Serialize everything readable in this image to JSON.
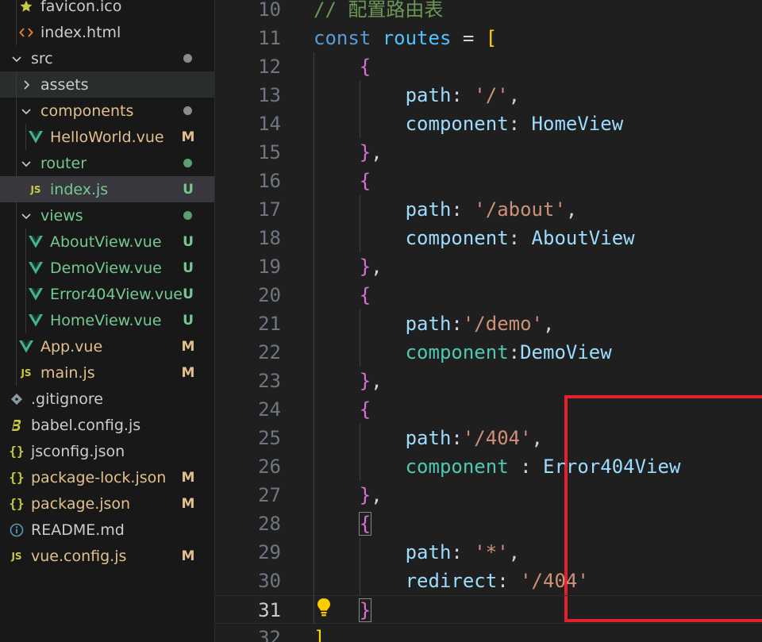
{
  "explorer": {
    "items": [
      {
        "label": "favicon.ico",
        "icon": "star-icon",
        "indent": 1,
        "kind": "file",
        "icon_color": "#cbcb41",
        "label_color": "#cccccc",
        "badge": "",
        "dot": ""
      },
      {
        "label": "index.html",
        "icon": "html-code-icon",
        "indent": 1,
        "kind": "file",
        "icon_color": "#e37933",
        "label_color": "#cccccc",
        "badge": "",
        "dot": ""
      },
      {
        "label": "src",
        "icon": "chevron-down-icon",
        "indent": 0,
        "kind": "folder",
        "icon_color": "#cccccc",
        "label_color": "#cccccc",
        "badge": "",
        "dot": "#8b8b8b"
      },
      {
        "label": "assets",
        "icon": "chevron-right-icon",
        "indent": 1,
        "kind": "folder",
        "icon_color": "#cccccc",
        "label_color": "#cccccc",
        "badge": "",
        "dot": "",
        "state": "hover"
      },
      {
        "label": "components",
        "icon": "chevron-down-icon",
        "indent": 1,
        "kind": "folder",
        "icon_color": "#cccccc",
        "label_color": "#e2c08d",
        "badge": "",
        "dot": "#8b8b8b"
      },
      {
        "label": "HelloWorld.vue",
        "icon": "vue-icon",
        "indent": 2,
        "kind": "file",
        "icon_color": "#41b883",
        "label_color": "#e2c08d",
        "badge": "M",
        "badge_color": "#e2c08d",
        "dot": ""
      },
      {
        "label": "router",
        "icon": "chevron-down-icon",
        "indent": 1,
        "kind": "folder",
        "icon_color": "#cccccc",
        "label_color": "#73c991",
        "badge": "",
        "dot": "#5a9f6e"
      },
      {
        "label": "index.js",
        "icon": "js-icon",
        "indent": 2,
        "kind": "file",
        "icon_color": "#cbcb41",
        "label_color": "#73c991",
        "badge": "U",
        "badge_color": "#73c991",
        "dot": "",
        "state": "selected"
      },
      {
        "label": "views",
        "icon": "chevron-down-icon",
        "indent": 1,
        "kind": "folder",
        "icon_color": "#cccccc",
        "label_color": "#73c991",
        "badge": "",
        "dot": "#5a9f6e"
      },
      {
        "label": "AboutView.vue",
        "icon": "vue-icon",
        "indent": 2,
        "kind": "file",
        "icon_color": "#41b883",
        "label_color": "#73c991",
        "badge": "U",
        "badge_color": "#73c991",
        "dot": ""
      },
      {
        "label": "DemoView.vue",
        "icon": "vue-icon",
        "indent": 2,
        "kind": "file",
        "icon_color": "#41b883",
        "label_color": "#73c991",
        "badge": "U",
        "badge_color": "#73c991",
        "dot": ""
      },
      {
        "label": "Error404View.vue",
        "icon": "vue-icon",
        "indent": 2,
        "kind": "file",
        "icon_color": "#41b883",
        "label_color": "#73c991",
        "badge": "U",
        "badge_color": "#73c991",
        "dot": ""
      },
      {
        "label": "HomeView.vue",
        "icon": "vue-icon",
        "indent": 2,
        "kind": "file",
        "icon_color": "#41b883",
        "label_color": "#73c991",
        "badge": "U",
        "badge_color": "#73c991",
        "dot": ""
      },
      {
        "label": "App.vue",
        "icon": "vue-icon",
        "indent": 1,
        "kind": "file",
        "icon_color": "#41b883",
        "label_color": "#e2c08d",
        "badge": "M",
        "badge_color": "#e2c08d",
        "dot": ""
      },
      {
        "label": "main.js",
        "icon": "js-icon",
        "indent": 1,
        "kind": "file",
        "icon_color": "#cbcb41",
        "label_color": "#e2c08d",
        "badge": "M",
        "badge_color": "#e2c08d",
        "dot": ""
      },
      {
        "label": ".gitignore",
        "icon": "git-icon",
        "indent": 0,
        "kind": "file",
        "icon_color": "#41535b",
        "label_color": "#cccccc",
        "badge": "",
        "dot": ""
      },
      {
        "label": "babel.config.js",
        "icon": "babel-icon",
        "indent": 0,
        "kind": "file",
        "icon_color": "#cbcb41",
        "label_color": "#cccccc",
        "badge": "",
        "dot": ""
      },
      {
        "label": "jsconfig.json",
        "icon": "json-braces-icon",
        "indent": 0,
        "kind": "file",
        "icon_color": "#cbcb41",
        "label_color": "#cccccc",
        "badge": "",
        "dot": ""
      },
      {
        "label": "package-lock.json",
        "icon": "json-braces-icon",
        "indent": 0,
        "kind": "file",
        "icon_color": "#cbcb41",
        "label_color": "#e2c08d",
        "badge": "M",
        "badge_color": "#e2c08d",
        "dot": ""
      },
      {
        "label": "package.json",
        "icon": "json-braces-icon",
        "indent": 0,
        "kind": "file",
        "icon_color": "#cbcb41",
        "label_color": "#e2c08d",
        "badge": "M",
        "badge_color": "#e2c08d",
        "dot": ""
      },
      {
        "label": "README.md",
        "icon": "info-icon",
        "indent": 0,
        "kind": "file",
        "icon_color": "#519aba",
        "label_color": "#cccccc",
        "badge": "",
        "dot": ""
      },
      {
        "label": "vue.config.js",
        "icon": "js-icon",
        "indent": 0,
        "kind": "file",
        "icon_color": "#cbcb41",
        "label_color": "#e2c08d",
        "badge": "M",
        "badge_color": "#e2c08d",
        "dot": ""
      }
    ]
  },
  "editor": {
    "current_line": 31,
    "colors": {
      "comment": "#6a9955",
      "keyword": "#569cd6",
      "variable": "#4fc1ff",
      "property": "#9cdcfe",
      "string": "#ce9178",
      "class": "#4ec9b0",
      "punct": "#d4d4d4",
      "bracket1": "#ffd700",
      "bracket2": "#da70d6"
    },
    "lines": [
      {
        "num": "10",
        "tokens": [
          {
            "t": "// 配置路由表",
            "c": "comment"
          }
        ]
      },
      {
        "num": "11",
        "tokens": [
          {
            "t": "const",
            "c": "keyword"
          },
          {
            "t": " ",
            "c": "punct"
          },
          {
            "t": "routes",
            "c": "variable"
          },
          {
            "t": " = ",
            "c": "punct"
          },
          {
            "t": "[",
            "c": "bracket1"
          }
        ]
      },
      {
        "num": "12",
        "tokens": [
          {
            "t": "    ",
            "c": "punct"
          },
          {
            "t": "{",
            "c": "bracket2"
          }
        ]
      },
      {
        "num": "13",
        "tokens": [
          {
            "t": "        ",
            "c": "punct"
          },
          {
            "t": "path",
            "c": "property"
          },
          {
            "t": ": ",
            "c": "punct"
          },
          {
            "t": "'/'",
            "c": "string"
          },
          {
            "t": ",",
            "c": "punct"
          }
        ]
      },
      {
        "num": "14",
        "tokens": [
          {
            "t": "        ",
            "c": "punct"
          },
          {
            "t": "component",
            "c": "property"
          },
          {
            "t": ": ",
            "c": "punct"
          },
          {
            "t": "HomeView",
            "c": "property"
          }
        ]
      },
      {
        "num": "15",
        "tokens": [
          {
            "t": "    ",
            "c": "punct"
          },
          {
            "t": "}",
            "c": "bracket2"
          },
          {
            "t": ",",
            "c": "punct"
          }
        ]
      },
      {
        "num": "16",
        "tokens": [
          {
            "t": "    ",
            "c": "punct"
          },
          {
            "t": "{",
            "c": "bracket2"
          }
        ]
      },
      {
        "num": "17",
        "tokens": [
          {
            "t": "        ",
            "c": "punct"
          },
          {
            "t": "path",
            "c": "property"
          },
          {
            "t": ": ",
            "c": "punct"
          },
          {
            "t": "'/about'",
            "c": "string"
          },
          {
            "t": ",",
            "c": "punct"
          }
        ]
      },
      {
        "num": "18",
        "tokens": [
          {
            "t": "        ",
            "c": "punct"
          },
          {
            "t": "component",
            "c": "property"
          },
          {
            "t": ": ",
            "c": "punct"
          },
          {
            "t": "AboutView",
            "c": "property"
          }
        ]
      },
      {
        "num": "19",
        "tokens": [
          {
            "t": "    ",
            "c": "punct"
          },
          {
            "t": "}",
            "c": "bracket2"
          },
          {
            "t": ",",
            "c": "punct"
          }
        ]
      },
      {
        "num": "20",
        "tokens": [
          {
            "t": "    ",
            "c": "punct"
          },
          {
            "t": "{",
            "c": "bracket2"
          }
        ]
      },
      {
        "num": "21",
        "tokens": [
          {
            "t": "        ",
            "c": "punct"
          },
          {
            "t": "path",
            "c": "property"
          },
          {
            "t": ":",
            "c": "punct"
          },
          {
            "t": "'/demo'",
            "c": "string"
          },
          {
            "t": ",",
            "c": "punct"
          }
        ]
      },
      {
        "num": "22",
        "tokens": [
          {
            "t": "        ",
            "c": "punct"
          },
          {
            "t": "component",
            "c": "class"
          },
          {
            "t": ":",
            "c": "punct"
          },
          {
            "t": "DemoView",
            "c": "property"
          }
        ]
      },
      {
        "num": "23",
        "tokens": [
          {
            "t": "    ",
            "c": "punct"
          },
          {
            "t": "}",
            "c": "bracket2"
          },
          {
            "t": ",",
            "c": "punct"
          }
        ]
      },
      {
        "num": "24",
        "tokens": [
          {
            "t": "    ",
            "c": "punct"
          },
          {
            "t": "{",
            "c": "bracket2"
          }
        ]
      },
      {
        "num": "25",
        "tokens": [
          {
            "t": "        ",
            "c": "punct"
          },
          {
            "t": "path",
            "c": "property"
          },
          {
            "t": ":",
            "c": "punct"
          },
          {
            "t": "'/404'",
            "c": "string"
          },
          {
            "t": ",",
            "c": "punct"
          }
        ]
      },
      {
        "num": "26",
        "tokens": [
          {
            "t": "        ",
            "c": "punct"
          },
          {
            "t": "component",
            "c": "class"
          },
          {
            "t": " : ",
            "c": "punct"
          },
          {
            "t": "Error404View",
            "c": "property"
          }
        ]
      },
      {
        "num": "27",
        "tokens": [
          {
            "t": "    ",
            "c": "punct"
          },
          {
            "t": "}",
            "c": "bracket2"
          },
          {
            "t": ",",
            "c": "punct"
          }
        ]
      },
      {
        "num": "28",
        "tokens": [
          {
            "t": "    ",
            "c": "punct"
          },
          {
            "t": "{",
            "c": "bracket2",
            "match": true
          }
        ]
      },
      {
        "num": "29",
        "tokens": [
          {
            "t": "        ",
            "c": "punct"
          },
          {
            "t": "path",
            "c": "property"
          },
          {
            "t": ": ",
            "c": "punct"
          },
          {
            "t": "'*'",
            "c": "string"
          },
          {
            "t": ",",
            "c": "punct"
          }
        ]
      },
      {
        "num": "30",
        "tokens": [
          {
            "t": "        ",
            "c": "punct"
          },
          {
            "t": "redirect",
            "c": "property"
          },
          {
            "t": ": ",
            "c": "punct"
          },
          {
            "t": "'/404'",
            "c": "string"
          }
        ]
      },
      {
        "num": "31",
        "tokens": [
          {
            "t": "    ",
            "c": "punct"
          },
          {
            "t": "}",
            "c": "bracket2",
            "match": true
          }
        ]
      },
      {
        "num": "32",
        "tokens": [
          {
            "t": "]",
            "c": "bracket1"
          }
        ]
      }
    ]
  }
}
